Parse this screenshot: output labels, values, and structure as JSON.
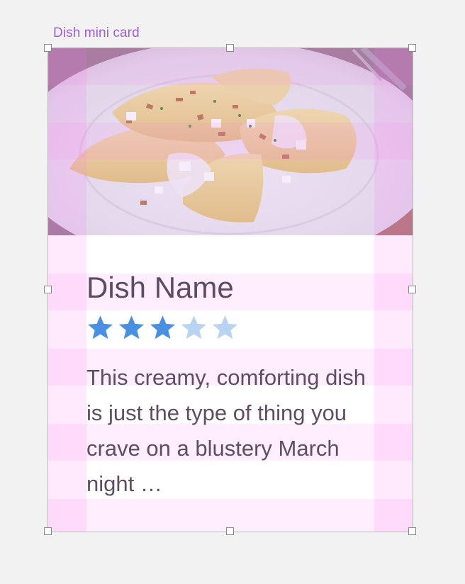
{
  "frame": {
    "label": "Dish mini card"
  },
  "card": {
    "image_alt": "Dish photo",
    "name": "Dish Name",
    "rating": {
      "value": 3,
      "max": 5,
      "filled_color": "#4a90e2",
      "empty_color": "#b9d3f3"
    },
    "description": "This creamy, comforting dish is just the type of thing you crave on a blustery March night …"
  },
  "overlay": {
    "grid_color": "#ff78f0"
  }
}
